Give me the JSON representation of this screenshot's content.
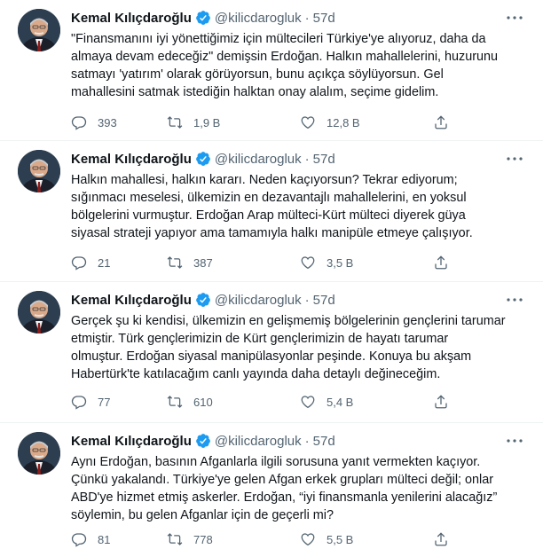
{
  "colors": {
    "text": "#0f1419",
    "muted": "#536471",
    "verified": "#1d9bf0",
    "divider": "#eff3f4"
  },
  "tweets": [
    {
      "name": "Kemal Kılıçdaroğlu",
      "handle": "@kilicdarogluk",
      "time": "57d",
      "text": "\"Finansmanını iyi yönettiğimiz için mültecileri Türkiye'ye alıyoruz, daha da\nalmaya devam edeceğiz\" demişsin Erdoğan. Halkın mahallelerini, huzurunu\nsatmayı 'yatırım' olarak görüyorsun, bunu açıkça söylüyorsun. Gel\nmahallesini satmak istediğin halktan onay alalım, seçime gidelim.",
      "replies": "393",
      "retweets": "1,9 B",
      "likes": "12,8 B"
    },
    {
      "name": "Kemal Kılıçdaroğlu",
      "handle": "@kilicdarogluk",
      "time": "57d",
      "text": "Halkın mahallesi, halkın kararı. Neden kaçıyorsun? Tekrar ediyorum;\nsığınmacı meselesi, ülkemizin en dezavantajlı mahallelerini, en yoksul\nbölgelerini vurmuştur. Erdoğan Arap mülteci-Kürt mülteci diyerek güya\nsiyasal strateji yapıyor ama tamamıyla halkı manipüle etmeye çalışıyor.",
      "replies": "21",
      "retweets": "387",
      "likes": "3,5 B"
    },
    {
      "name": "Kemal Kılıçdaroğlu",
      "handle": "@kilicdarogluk",
      "time": "57d",
      "text": "Gerçek şu ki kendisi, ülkemizin en gelişmemiş bölgelerinin gençlerini tarumar\netmiştir. Türk gençlerimizin de Kürt gençlerimizin de hayatı tarumar\nolmuştur. Erdoğan siyasal manipülasyonlar peşinde. Konuya bu akşam\nHabertürk'te katılacağım canlı yayında daha detaylı değineceğim.",
      "replies": "77",
      "retweets": "610",
      "likes": "5,4 B"
    },
    {
      "name": "Kemal Kılıçdaroğlu",
      "handle": "@kilicdarogluk",
      "time": "57d",
      "text": "Aynı Erdoğan, basının Afganlarla ilgili sorusuna yanıt vermekten kaçıyor.\nÇünkü yakalandı. Türkiye'ye gelen Afgan erkek grupları mülteci değil; onlar\nABD'ye hizmet etmiş askerler. Erdoğan, “iyi finansmanla yenilerini alacağız”\nsöylemin, bu gelen Afganlar için de geçerli mi?",
      "replies": "81",
      "retweets": "778",
      "likes": "5,5 B"
    }
  ]
}
